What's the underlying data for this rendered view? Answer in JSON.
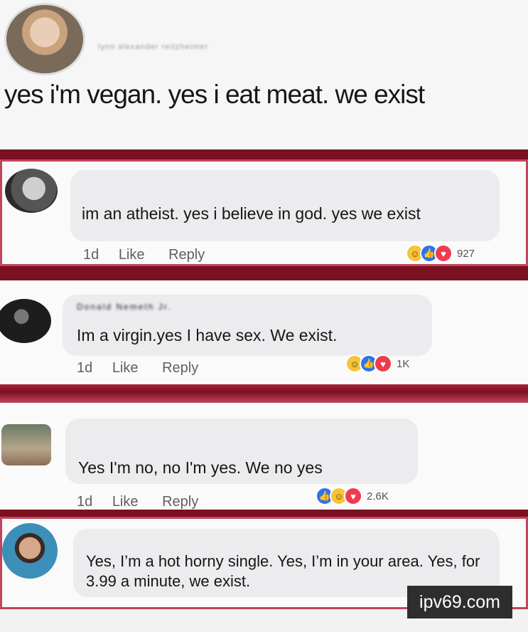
{
  "post": {
    "author": "lynn alexander reitzheimer",
    "text": "yes i'm vegan. yes i eat meat. we exist"
  },
  "comments": [
    {
      "author": "",
      "text": "im an atheist.  yes i believe in god.  yes we exist",
      "time": "1d",
      "like": "Like",
      "reply": "Reply",
      "reactions": [
        "haha",
        "like",
        "love"
      ],
      "count": "927"
    },
    {
      "author": "Donald Nemeth Jr.",
      "text": "Im a virgin.yes I have sex. We exist.",
      "time": "1d",
      "like": "Like",
      "reply": "Reply",
      "reactions": [
        "haha",
        "like",
        "love"
      ],
      "count": "1K"
    },
    {
      "author": "",
      "text": "Yes I'm no, no I'm yes. We no yes",
      "time": "1d",
      "like": "Like",
      "reply": "Reply",
      "reactions": [
        "like",
        "haha",
        "love"
      ],
      "count": "2.6K"
    },
    {
      "author": "",
      "text": "Yes, I’m a hot horny single. Yes, I’m in your area. Yes, for 3.99 a minute, we exist."
    }
  ],
  "watermark": "ipv69.com",
  "colors": {
    "separator": "#7a1020",
    "panel_border": "#c0455d",
    "like": "#2b73f0",
    "love": "#ef3b4f",
    "haha": "#f6c33a"
  }
}
